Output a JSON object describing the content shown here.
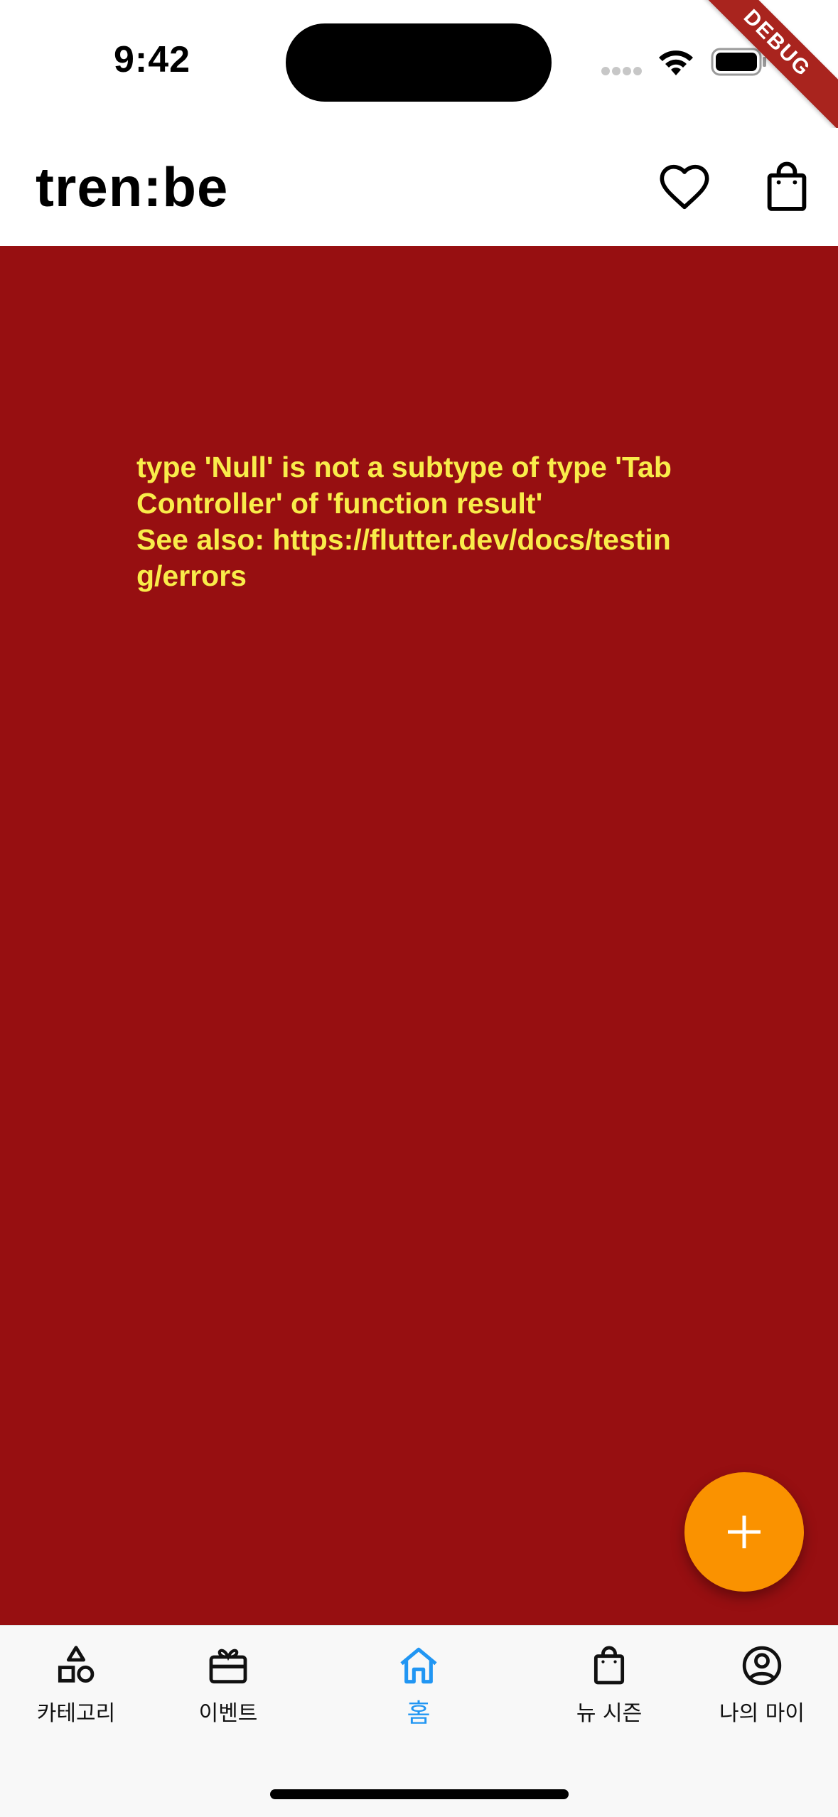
{
  "status_bar": {
    "time": "9:42",
    "debug_banner": "DEBUG"
  },
  "app_bar": {
    "title": "tren:be",
    "actions": [
      {
        "icon": "heart-icon"
      },
      {
        "icon": "shopping-bag-icon"
      }
    ]
  },
  "error": {
    "message": "type 'Null' is not a subtype of type 'TabController' of 'function result'",
    "see_also": "See also: https://flutter.dev/docs/testing/errors",
    "background_color": "#970f11",
    "text_color": "#f9ec4a"
  },
  "fab": {
    "icon": "plus-icon",
    "color": "#fa9200"
  },
  "bottom_nav": {
    "active_color": "#2196f3",
    "items": [
      {
        "label": "카테고리",
        "icon": "category-shapes-icon"
      },
      {
        "label": "이벤트",
        "icon": "gift-box-icon"
      },
      {
        "label": "홈",
        "icon": "home-icon",
        "active": true
      },
      {
        "label": "뉴 시즌",
        "icon": "shopping-bag-icon"
      },
      {
        "label": "나의 마이",
        "icon": "account-circle-icon"
      }
    ]
  }
}
